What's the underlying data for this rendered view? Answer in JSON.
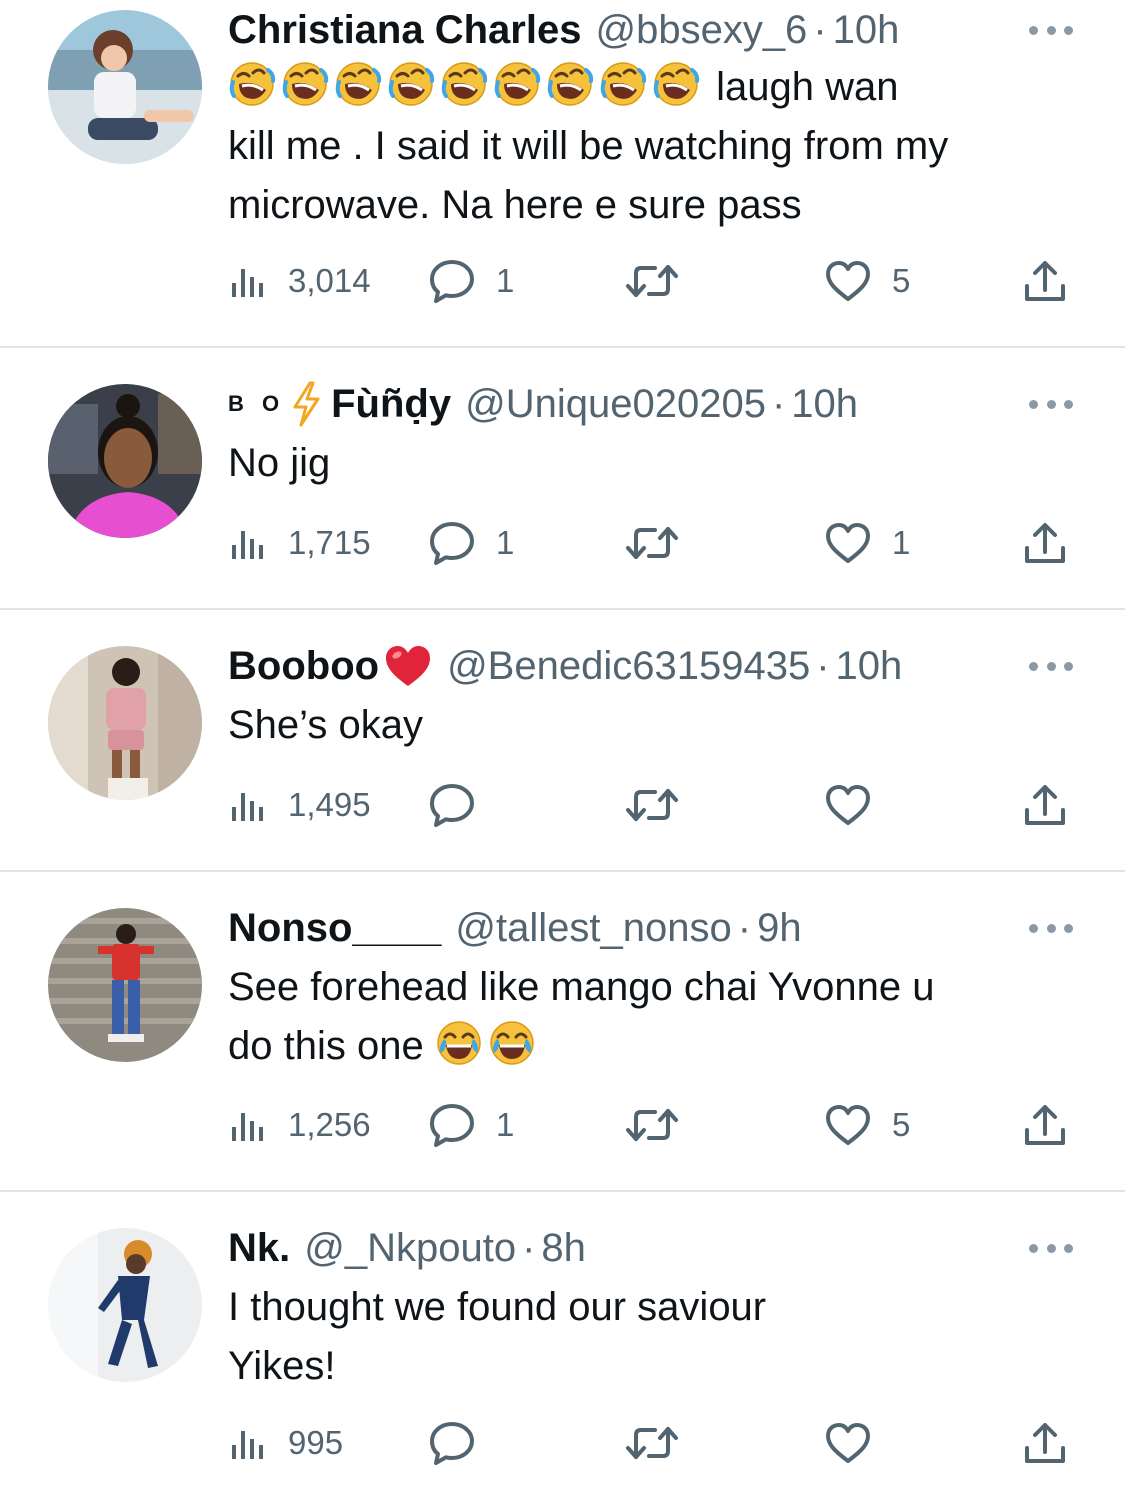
{
  "tweets": [
    {
      "name": "Christiana Charles",
      "handle": "@bbsexy_6",
      "time": "10h",
      "text_lines": [
        "laugh wan",
        "kill me . I said it will be watching from my",
        "microwave. Na here e sure pass"
      ],
      "leading_emoji": "rolling-on-floor-laughing x9",
      "views": "3,014",
      "replies": "1",
      "retweets": "",
      "likes": "5"
    },
    {
      "name_prefix": "B O",
      "name": "Fùñḍy",
      "handle": "@Unique020205",
      "time": "10h",
      "text_lines": [
        "No jig"
      ],
      "views": "1,715",
      "replies": "1",
      "retweets": "",
      "likes": "1"
    },
    {
      "name": "Booboo",
      "handle": "@Benedic63159435",
      "time": "10h",
      "text_lines": [
        "She’s okay"
      ],
      "views": "1,495",
      "replies": "",
      "retweets": "",
      "likes": ""
    },
    {
      "name": "Nonso____",
      "handle": "@tallest_nonso",
      "time": "9h",
      "text_lines": [
        "See forehead like mango chai Yvonne u",
        "do this one"
      ],
      "trailing_emoji": "face-with-tears-of-joy x2",
      "views": "1,256",
      "replies": "1",
      "retweets": "",
      "likes": "5"
    },
    {
      "name": "Nk.",
      "handle": "@_Nkpouto",
      "time": "8h",
      "text_lines": [
        "I thought we found our saviour",
        "Yikes!"
      ],
      "views": "995",
      "replies": "",
      "retweets": "",
      "likes": ""
    }
  ],
  "separator": "·",
  "colors": {
    "text": "#0f1419",
    "secondary": "#536471",
    "divider": "#e1e4e7",
    "bolt": "#f4a623",
    "heart_emoji": "#e0243a"
  },
  "icons": [
    "views-icon",
    "reply-icon",
    "retweet-icon",
    "like-icon",
    "share-icon",
    "more-icon"
  ]
}
